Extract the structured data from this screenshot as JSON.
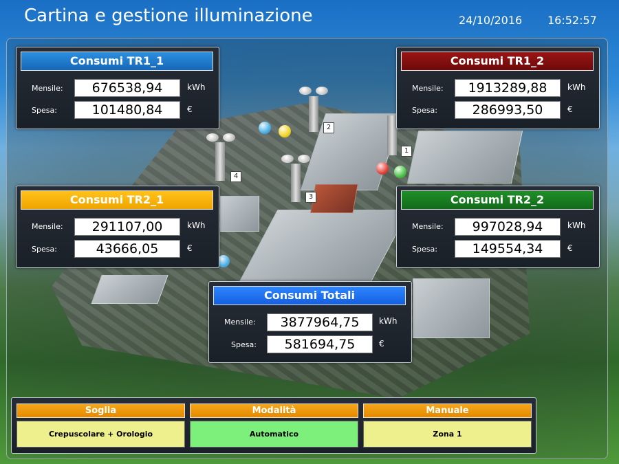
{
  "header": {
    "title": "Cartina e gestione illuminazione",
    "date": "24/10/2016",
    "time": "16:52:57"
  },
  "colors": {
    "tr1_1": "#1a78c8",
    "tr1_2": "#7a0f0f",
    "tr2_1": "#f6b300",
    "tr2_2": "#18801f",
    "totali": "#1f6ff0",
    "bottom_header": "#f09a10",
    "bottom_yellow": "#eef08e",
    "bottom_green": "#7cf07a"
  },
  "cards": {
    "tr1_1": {
      "title": "Consumi TR1_1",
      "mensile_label": "Mensile:",
      "mensile": "676538,94",
      "mensile_unit": "kWh",
      "spesa_label": "Spesa:",
      "spesa": "101480,84",
      "spesa_unit": "€"
    },
    "tr1_2": {
      "title": "Consumi TR1_2",
      "mensile_label": "Mensile:",
      "mensile": "1913289,88",
      "mensile_unit": "kWh",
      "spesa_label": "Spesa:",
      "spesa": "286993,50",
      "spesa_unit": "€"
    },
    "tr2_1": {
      "title": "Consumi TR2_1",
      "mensile_label": "Mensile:",
      "mensile": "291107,00",
      "mensile_unit": "kWh",
      "spesa_label": "Spesa:",
      "spesa": "43666,05",
      "spesa_unit": "€"
    },
    "tr2_2": {
      "title": "Consumi TR2_2",
      "mensile_label": "Mensile:",
      "mensile": "997028,94",
      "mensile_unit": "kWh",
      "spesa_label": "Spesa:",
      "spesa": "149554,34",
      "spesa_unit": "€"
    },
    "totali": {
      "title": "Consumi Totali",
      "mensile_label": "Mensile:",
      "mensile": "3877964,75",
      "mensile_unit": "kWh",
      "spesa_label": "Spesa:",
      "spesa": "581694,75",
      "spesa_unit": "€"
    }
  },
  "lamps": [
    {
      "number": "1",
      "icon": "street-lamp-icon"
    },
    {
      "number": "2",
      "icon": "street-lamp-icon"
    },
    {
      "number": "3",
      "icon": "street-lamp-icon"
    },
    {
      "number": "4",
      "icon": "street-lamp-icon"
    }
  ],
  "indicators": [
    {
      "color": "blue",
      "icon": "status-light-icon"
    },
    {
      "color": "yellow",
      "icon": "status-light-icon"
    },
    {
      "color": "red",
      "icon": "status-light-icon"
    },
    {
      "color": "green",
      "icon": "status-light-icon"
    },
    {
      "color": "blue",
      "icon": "status-light-icon"
    }
  ],
  "bottom": {
    "soglia_label": "Soglia",
    "soglia_value": "Crepuscolare + Orologio",
    "modalita_label": "Modalità",
    "modalita_value": "Automatico",
    "manuale_label": "Manuale",
    "manuale_value": "Zona 1"
  }
}
